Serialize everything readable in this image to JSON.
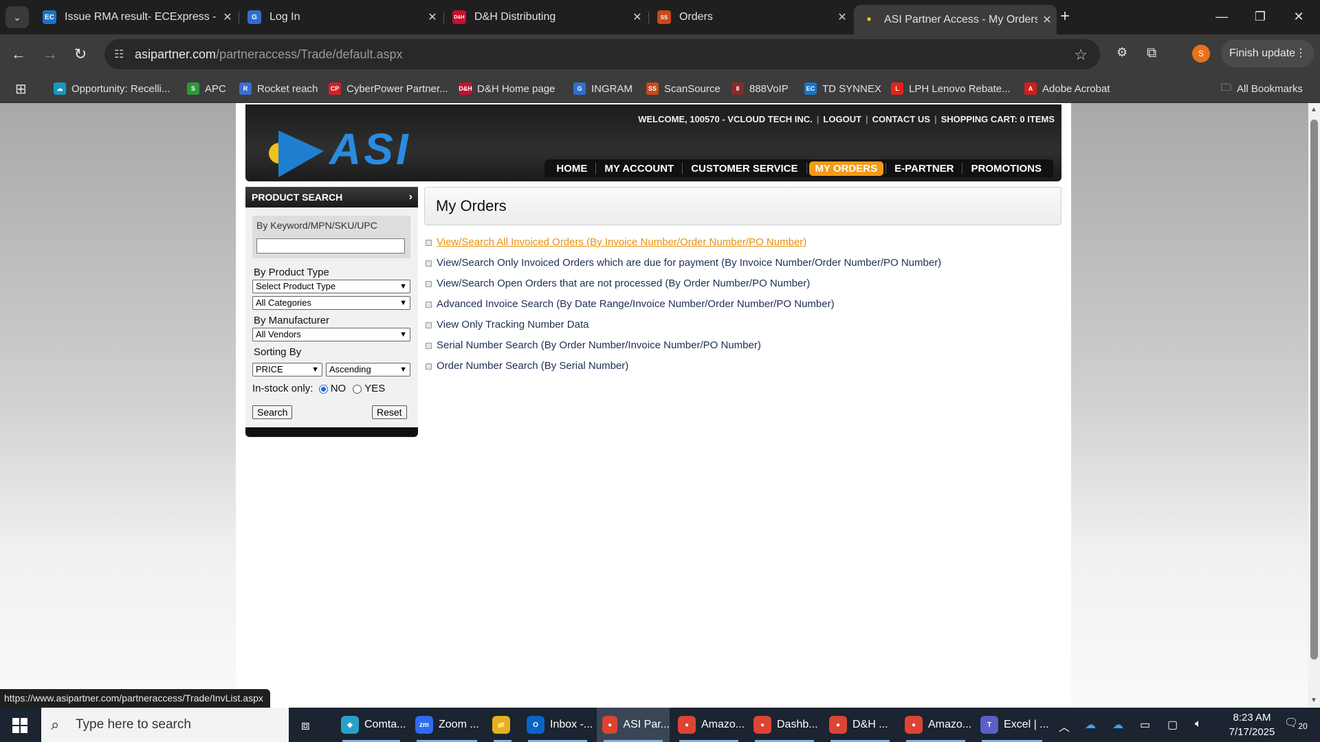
{
  "browser": {
    "tabs": [
      {
        "title": "Issue RMA result- ECExpress - T",
        "favicon": "EC",
        "color": "#1a73c8"
      },
      {
        "title": "Log In",
        "favicon": "G",
        "color": "#2f6fd0"
      },
      {
        "title": "D&H Distributing",
        "favicon": "D&H",
        "color": "#c8102e"
      },
      {
        "title": "Orders",
        "favicon": "SS",
        "color": "#c84a1a"
      },
      {
        "title": "ASI Partner Access - My Orders",
        "favicon": "•",
        "color": "#2a8be0"
      }
    ],
    "url_host": "asipartner.com",
    "url_path": "/partneraccess/Trade/default.aspx",
    "profile_initial": "S",
    "finish_update_label": "Finish update",
    "bookmarks": [
      {
        "label": "Opportunity: Recelli...",
        "icon": "cloud",
        "color": "#1798c1"
      },
      {
        "label": "APC",
        "icon": "S",
        "color": "#2b9b3a"
      },
      {
        "label": "Rocket reach",
        "icon": "R",
        "color": "#3a6fd0"
      },
      {
        "label": "CyberPower Partner...",
        "icon": "CP",
        "color": "#d0202a"
      },
      {
        "label": "D&H Home page",
        "icon": "D&H",
        "color": "#c8102e"
      },
      {
        "label": "INGRAM",
        "icon": "G",
        "color": "#2f6fd0"
      },
      {
        "label": "ScanSource",
        "icon": "SS",
        "color": "#c84a1a"
      },
      {
        "label": "888VoIP",
        "icon": "8",
        "color": "#8a2a2a"
      },
      {
        "label": "TD SYNNEX",
        "icon": "EC",
        "color": "#1a73c8"
      },
      {
        "label": "LPH Lenovo Rebate...",
        "icon": "L",
        "color": "#e2231a"
      },
      {
        "label": "Adobe Acrobat",
        "icon": "A",
        "color": "#d01f1f"
      }
    ],
    "all_bookmarks_label": "All Bookmarks",
    "status_url": "https://www.asipartner.com/partneraccess/Trade/InvList.aspx"
  },
  "asi": {
    "logo_text": "ASI",
    "welcome": "WELCOME, 100570 - VCLOUD TECH INC.",
    "logout": "LOGOUT",
    "contact": "CONTACT US",
    "cart": "SHOPPING CART: 0 ITEMS",
    "nav": [
      "HOME",
      "MY ACCOUNT",
      "CUSTOMER SERVICE",
      "MY ORDERS",
      "E-PARTNER",
      "PROMOTIONS"
    ],
    "active_nav": "MY ORDERS"
  },
  "product_search": {
    "title": "PRODUCT SEARCH",
    "keyword_label": "By Keyword/MPN/SKU/UPC",
    "keyword_value": "",
    "product_type_label": "By Product Type",
    "product_type_value": "Select Product Type",
    "category_value": "All Categories",
    "manufacturer_label": "By Manufacturer",
    "manufacturer_value": "All Vendors",
    "sorting_label": "Sorting By",
    "sort_field": "PRICE",
    "sort_order": "Ascending",
    "instock_label": "In-stock only:",
    "instock_no": "NO",
    "instock_yes": "YES",
    "search_button": "Search",
    "reset_button": "Reset"
  },
  "orders": {
    "title": "My Orders",
    "links": [
      "View/Search All Invoiced Orders (By Invoice Number/Order Number/PO Number)",
      "View/Search Only Invoiced Orders which are due for payment (By Invoice Number/Order Number/PO Number)",
      "View/Search Open Orders that are not processed (By Order Number/PO Number)",
      "Advanced Invoice Search (By Date Range/Invoice Number/Order Number/PO Number)",
      "View Only Tracking Number Data",
      "Serial Number Search (By Order Number/Invoice Number/PO Number)",
      "Order Number Search (By Serial Number)"
    ]
  },
  "taskbar": {
    "search_placeholder": "Type here to search",
    "apps": [
      {
        "label": "Comta...",
        "icon": "◆",
        "color": "#2aa0c8"
      },
      {
        "label": "Zoom ...",
        "icon": "zoom",
        "color": "#2d6cf0"
      },
      {
        "label": "",
        "icon": "📁",
        "color": "#e8b020"
      },
      {
        "label": "Inbox -...",
        "icon": "O",
        "color": "#0a64c8"
      },
      {
        "label": "ASI Par...",
        "icon": "●",
        "color": "#dd4433"
      },
      {
        "label": "Amazo...",
        "icon": "●",
        "color": "#dd4433"
      },
      {
        "label": "Dashb...",
        "icon": "●",
        "color": "#dd4433"
      },
      {
        "label": "D&H ...",
        "icon": "●",
        "color": "#dd4433"
      },
      {
        "label": "Amazo...",
        "icon": "●",
        "color": "#dd4433"
      },
      {
        "label": "Excel | ...",
        "icon": "T",
        "color": "#5b5fc7"
      }
    ],
    "time": "8:23 AM",
    "date": "7/17/2025",
    "notification_count": "20"
  }
}
